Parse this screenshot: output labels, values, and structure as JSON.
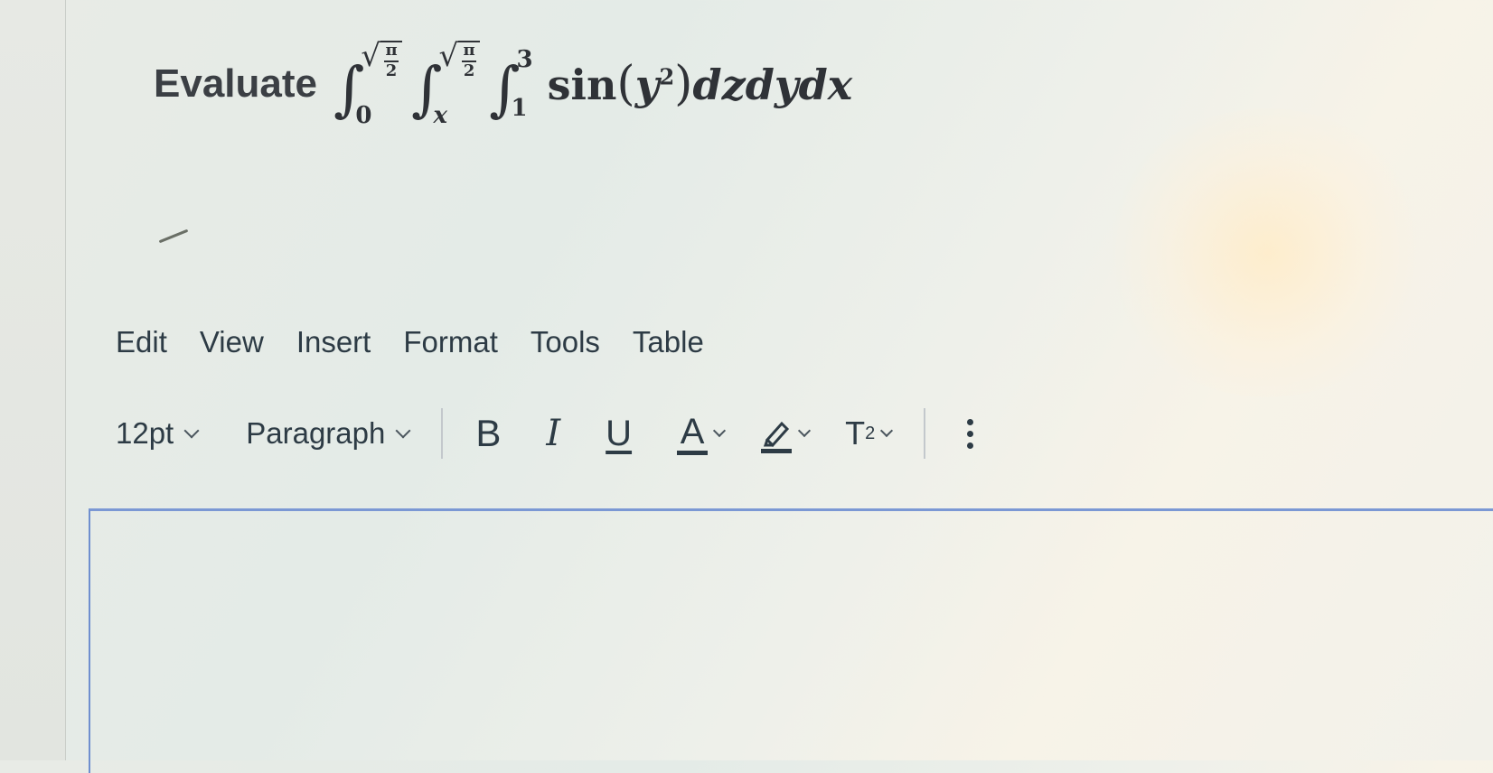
{
  "question": {
    "prefix": "Evaluate",
    "integrals": [
      {
        "upper": "π",
        "upper_den": "2",
        "lower": "0",
        "upper_is_root": true
      },
      {
        "upper": "π",
        "upper_den": "2",
        "lower": "x",
        "upper_is_root": true
      },
      {
        "upper": "3",
        "lower": "1",
        "upper_is_root": false
      }
    ],
    "integrand": {
      "func": "sin",
      "var": "y",
      "exp": "2",
      "diff": "dzdydx"
    }
  },
  "menubar": {
    "items": [
      "Edit",
      "View",
      "Insert",
      "Format",
      "Tools",
      "Table"
    ]
  },
  "toolbar": {
    "font_size": "12pt",
    "block_format": "Paragraph",
    "bold": "B",
    "italic": "I",
    "underline": "U",
    "text_color": "A",
    "superscript_base": "T",
    "superscript_exp": "2"
  },
  "colors": {
    "accent": "#7b98d4",
    "text": "#2d3b45"
  }
}
